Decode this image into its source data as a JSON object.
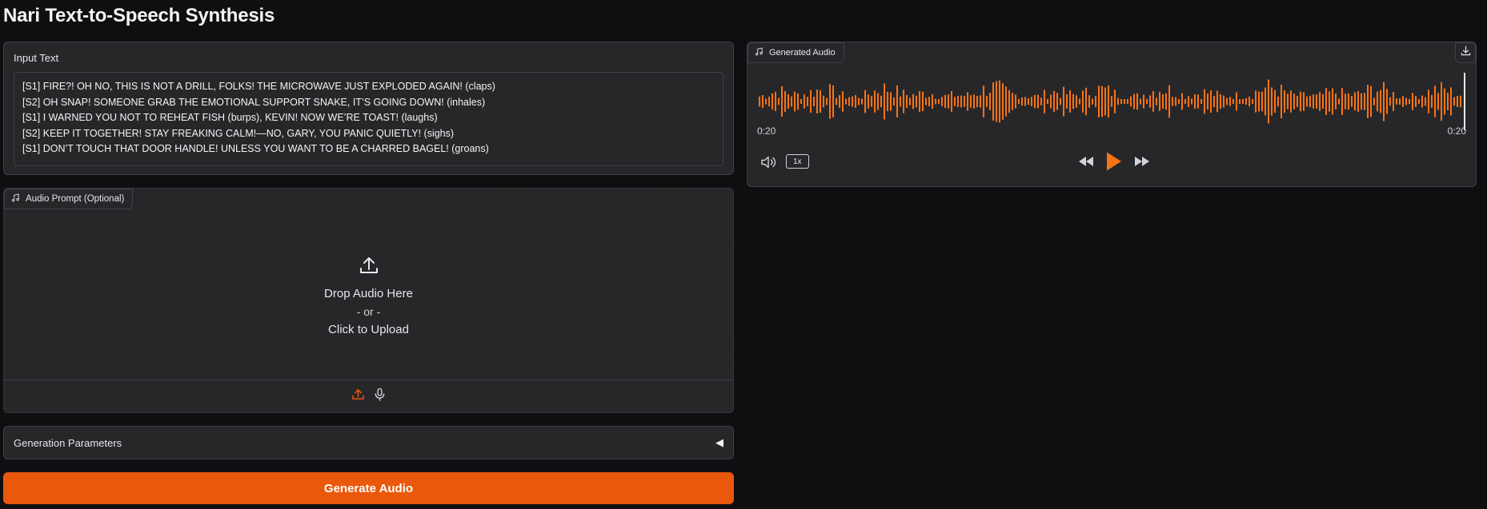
{
  "app": {
    "title": "Nari Text-to-Speech Synthesis"
  },
  "input": {
    "label": "Input Text",
    "lines": [
      "[S1] FIRE?! OH NO, THIS IS NOT A DRILL, FOLKS! THE MICROWAVE JUST EXPLODED AGAIN! (claps)",
      "[S2] OH SNAP! SOMEONE GRAB THE EMOTIONAL SUPPORT SNAKE, IT’S GOING DOWN! (inhales)",
      "[S1] I WARNED YOU NOT TO REHEAT FISH (burps), KEVIN! NOW WE’RE TOAST! (laughs)",
      "[S2] KEEP IT TOGETHER! STAY FREAKING CALM!—NO, GARY, YOU PANIC QUIETLY! (sighs)",
      "[S1] DON’T TOUCH THAT DOOR HANDLE! UNLESS YOU WANT TO BE A CHARRED BAGEL! (groans)"
    ]
  },
  "audio_prompt": {
    "label": "Audio Prompt (Optional)",
    "drop_text": "Drop Audio Here",
    "or_text": "- or -",
    "click_text": "Click to Upload",
    "sources": [
      "upload-icon",
      "microphone-icon"
    ],
    "active_source": "upload"
  },
  "params": {
    "label": "Generation Parameters",
    "caret": "◀"
  },
  "generate": {
    "label": "Generate Audio"
  },
  "output": {
    "label": "Generated Audio",
    "time_current": "0:20",
    "time_total": "0:20",
    "playback_rate": "1x"
  },
  "colors": {
    "accent": "#ea580c",
    "waveform": "#f97316",
    "background": "#0f0f11",
    "panel": "#27272a",
    "border": "#3f3f46"
  }
}
